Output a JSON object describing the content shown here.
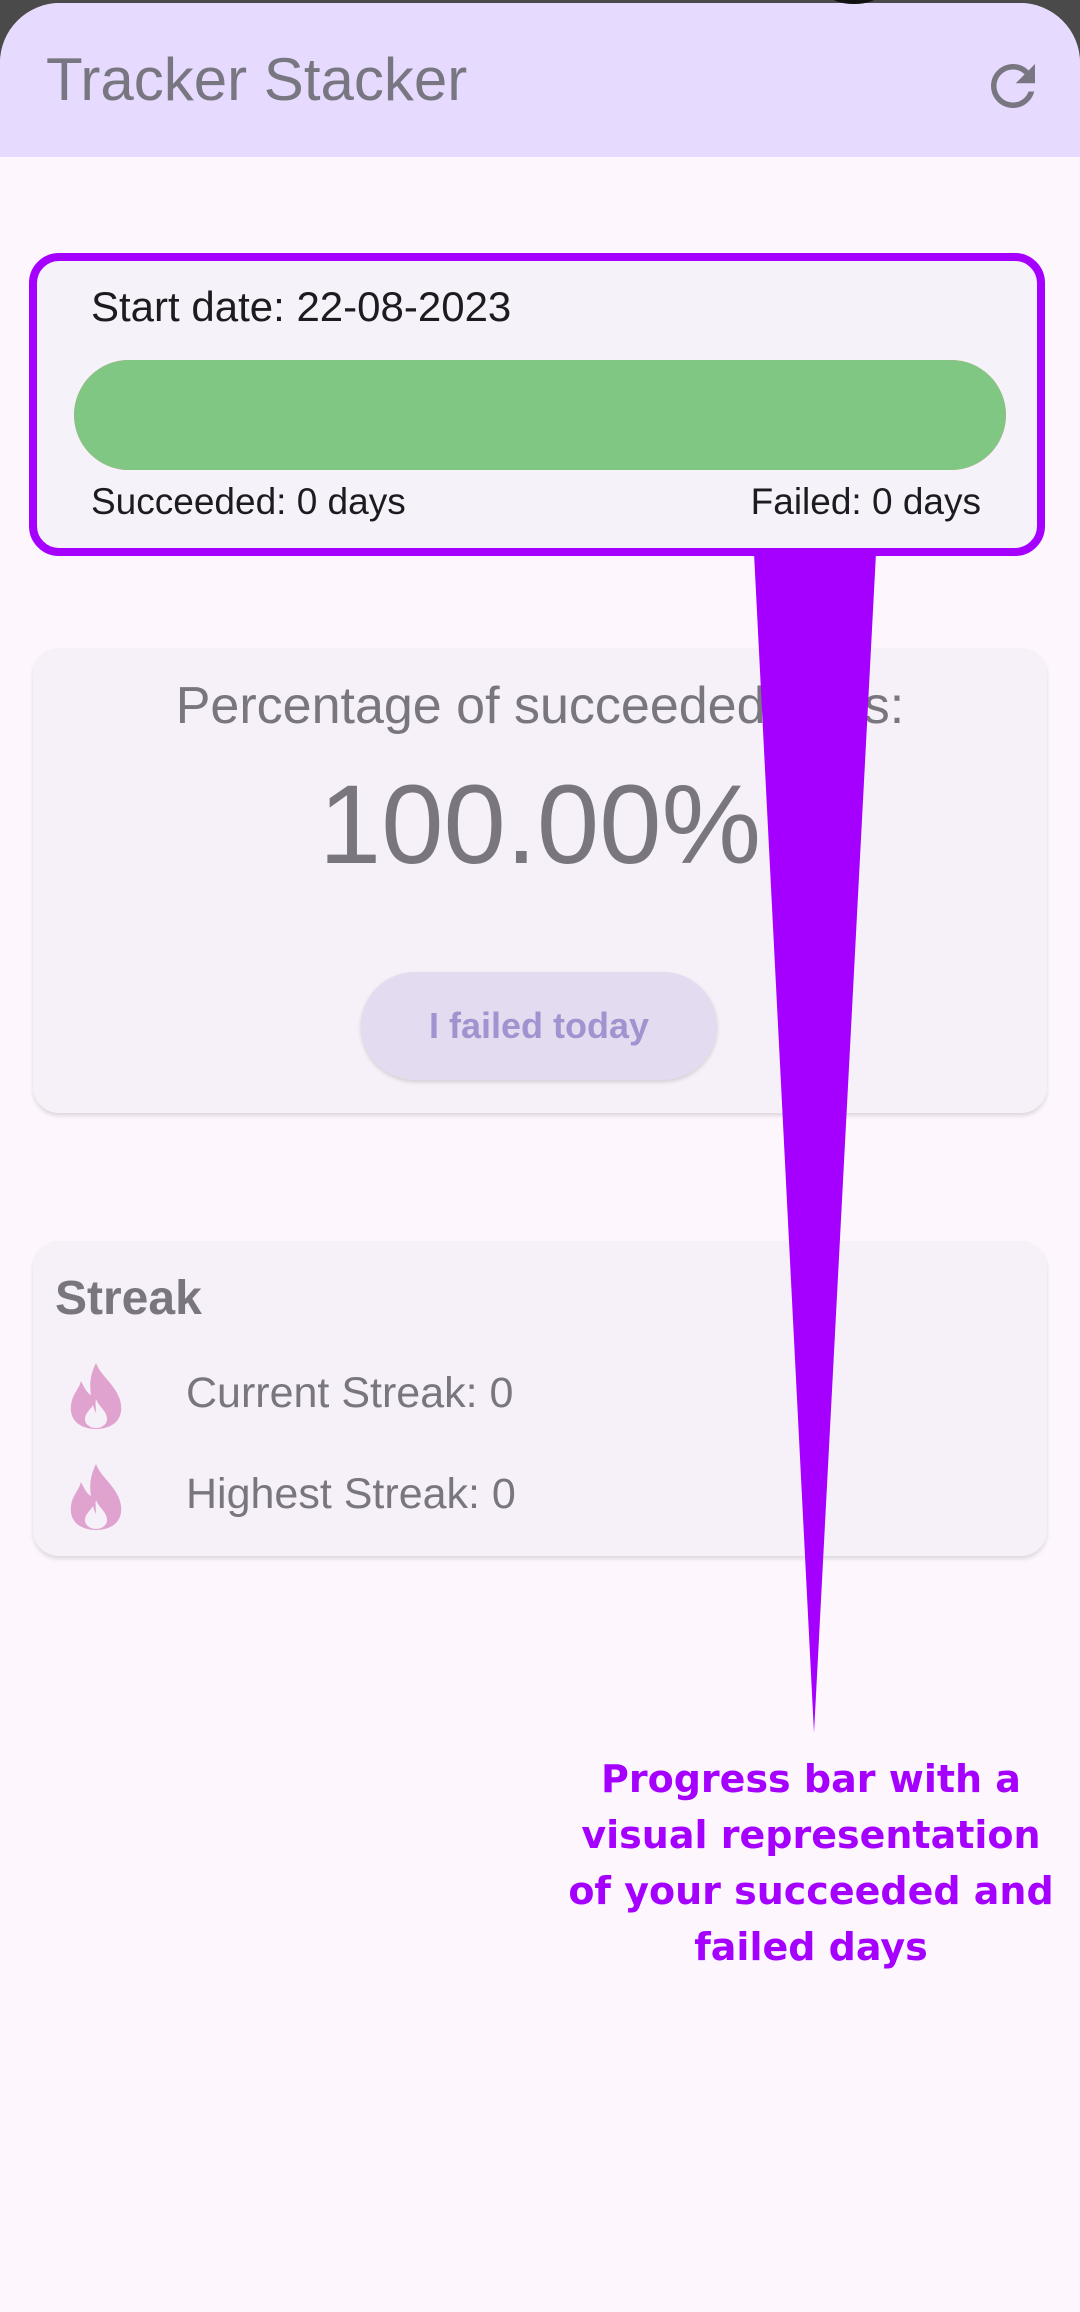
{
  "app": {
    "title": "Tracker Stacker",
    "refresh_icon": "refresh-icon"
  },
  "progress": {
    "start_date_label": "Start date: 22-08-2023",
    "succeeded_label": "Succeeded: 0 days",
    "failed_label": "Failed: 0 days",
    "fill_fraction": 1.0,
    "success_color": "#81c784",
    "fail_color": "#e57373",
    "highlight_color": "#a500ff"
  },
  "percentage": {
    "label": "Percentage of succeeded days:",
    "value": "100.00%",
    "button_label": "I failed today"
  },
  "streak": {
    "title": "Streak",
    "items": [
      {
        "icon": "flame-icon",
        "label": "Current Streak: 0"
      },
      {
        "icon": "flame-icon",
        "label": "Highest Streak: 0"
      }
    ]
  },
  "annotation": {
    "text": "Progress bar with a visual representation of your succeeded and failed days",
    "color": "#a500ff"
  }
}
